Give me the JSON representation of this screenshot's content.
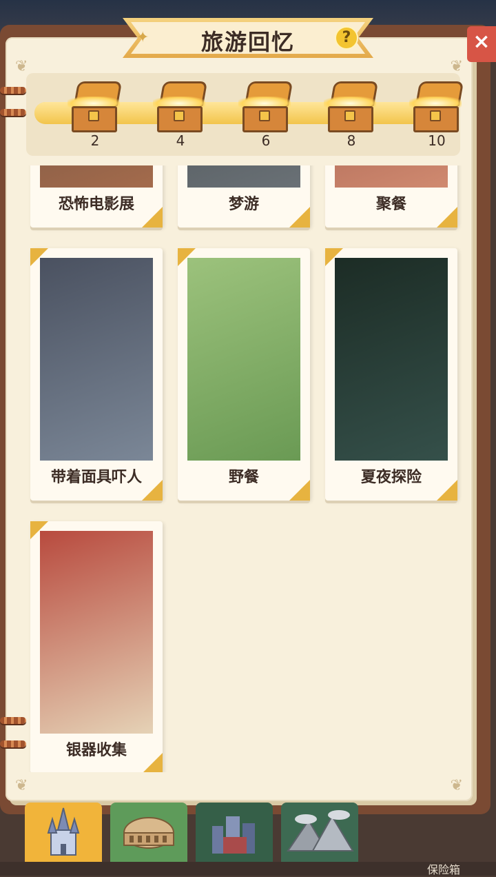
{
  "header": {
    "title": "旅游回忆",
    "help_icon": "?",
    "close_icon": "×"
  },
  "progress": {
    "fraction": 1.0,
    "milestones": [
      {
        "value": "2",
        "icon": "treasure-chest-icon"
      },
      {
        "value": "4",
        "icon": "treasure-chest-icon"
      },
      {
        "value": "6",
        "icon": "treasure-chest-icon"
      },
      {
        "value": "8",
        "icon": "treasure-chest-icon"
      },
      {
        "value": "10",
        "icon": "treasure-chest-icon"
      }
    ]
  },
  "cards": [
    {
      "label": "恐怖电影展"
    },
    {
      "label": "梦游"
    },
    {
      "label": "聚餐"
    },
    {
      "label": "带着面具吓人"
    },
    {
      "label": "野餐"
    },
    {
      "label": "夏夜探险"
    },
    {
      "label": "银器收集"
    }
  ],
  "tabs": [
    {
      "name": "castle-tab",
      "icon": "castle-icon",
      "active": true
    },
    {
      "name": "colosseum-tab",
      "icon": "colosseum-icon",
      "active": false
    },
    {
      "name": "city-tab",
      "icon": "city-icon",
      "active": false
    },
    {
      "name": "mountain-tab",
      "icon": "mountain-icon",
      "active": false
    }
  ],
  "footer": {
    "safe_label": "保险箱"
  },
  "colors": {
    "accent": "#e7b340",
    "page": "#f8f0dc",
    "close": "#d75546"
  }
}
